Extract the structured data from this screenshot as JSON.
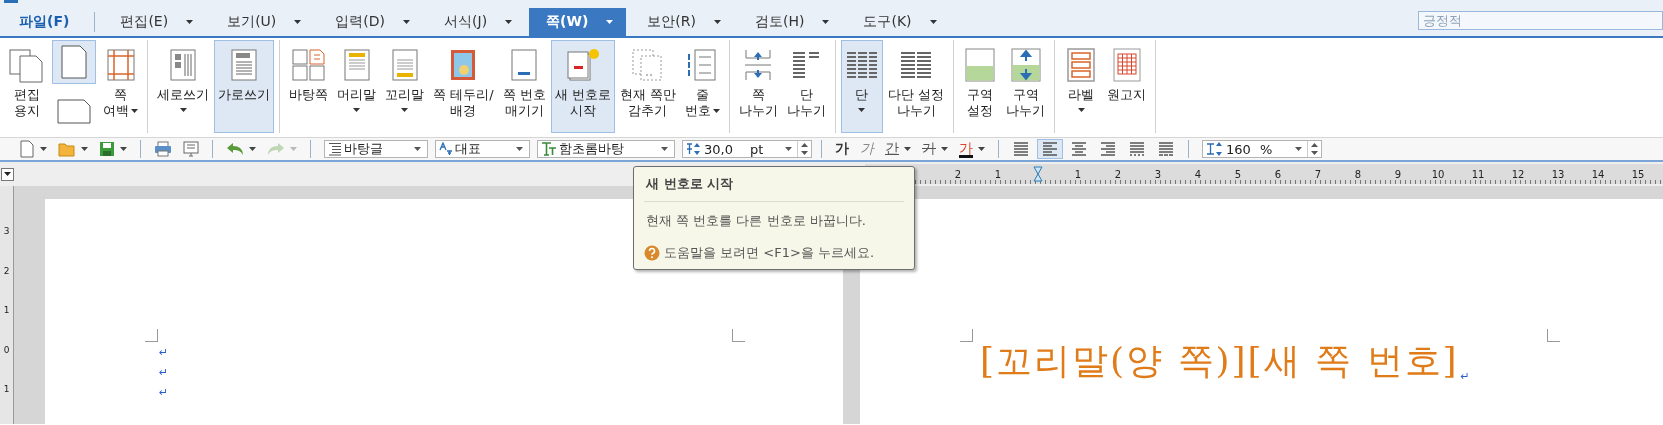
{
  "menu": [
    {
      "label": "파일(F)",
      "kind": "file",
      "selected": false
    },
    {
      "label": "편집(E)",
      "kind": "menu",
      "selected": false
    },
    {
      "label": "보기(U)",
      "kind": "menu",
      "selected": false
    },
    {
      "label": "입력(D)",
      "kind": "menu",
      "selected": false
    },
    {
      "label": "서식(J)",
      "kind": "menu",
      "selected": false
    },
    {
      "label": "쪽(W)",
      "kind": "menu",
      "selected": true
    },
    {
      "label": "보안(R)",
      "kind": "menu",
      "selected": false
    },
    {
      "label": "검토(H)",
      "kind": "menu",
      "selected": false
    },
    {
      "label": "도구(K)",
      "kind": "menu",
      "selected": false
    }
  ],
  "search": {
    "placeholder": "긍정적"
  },
  "ribbon": [
    {
      "items": [
        {
          "kind": "large",
          "lines": [
            "편집",
            "용지"
          ],
          "dropdown": false,
          "selected": false
        },
        {
          "kind": "stack",
          "buttons": [
            {
              "selected": true
            },
            {
              "selected": false
            }
          ]
        },
        {
          "kind": "large",
          "lines": [
            "쪽",
            "여백"
          ],
          "dropdown": true,
          "selected": false
        }
      ]
    },
    {
      "items": [
        {
          "kind": "large",
          "lines": [
            "세로쓰기"
          ],
          "dropdown": true,
          "selected": false
        },
        {
          "kind": "large",
          "lines": [
            "가로쓰기"
          ],
          "dropdown": false,
          "selected": true
        }
      ]
    },
    {
      "items": [
        {
          "kind": "large",
          "lines": [
            "바탕쪽"
          ],
          "dropdown": false,
          "selected": false
        },
        {
          "kind": "large",
          "lines": [
            "머리말"
          ],
          "dropdown": true,
          "selected": false
        },
        {
          "kind": "large",
          "lines": [
            "꼬리말"
          ],
          "dropdown": true,
          "selected": false
        },
        {
          "kind": "large",
          "lines": [
            "쪽 테두리/",
            "배경"
          ],
          "dropdown": false,
          "selected": false
        },
        {
          "kind": "large",
          "lines": [
            "쪽 번호",
            "매기기"
          ],
          "dropdown": false,
          "selected": false
        },
        {
          "kind": "large",
          "lines": [
            "새 번호로",
            "시작"
          ],
          "dropdown": false,
          "selected": true
        },
        {
          "kind": "large",
          "lines": [
            "현재 쪽만",
            "감추기"
          ],
          "dropdown": false,
          "selected": false
        },
        {
          "kind": "large",
          "lines": [
            "줄",
            "번호"
          ],
          "dropdown": true,
          "selected": false
        }
      ]
    },
    {
      "items": [
        {
          "kind": "large",
          "lines": [
            "쪽",
            "나누기"
          ],
          "dropdown": false,
          "selected": false
        },
        {
          "kind": "large",
          "lines": [
            "단",
            "나누기"
          ],
          "dropdown": false,
          "selected": false
        }
      ]
    },
    {
      "items": [
        {
          "kind": "large",
          "lines": [
            "단"
          ],
          "dropdown": true,
          "selected": true
        },
        {
          "kind": "large",
          "lines": [
            "다단 설정",
            "나누기"
          ],
          "dropdown": false,
          "selected": false
        }
      ]
    },
    {
      "items": [
        {
          "kind": "large",
          "lines": [
            "구역",
            "설정"
          ],
          "dropdown": false,
          "selected": false
        },
        {
          "kind": "large",
          "lines": [
            "구역",
            "나누기"
          ],
          "dropdown": false,
          "selected": false
        }
      ]
    },
    {
      "items": [
        {
          "kind": "large",
          "lines": [
            "라벨"
          ],
          "dropdown": true,
          "selected": false
        },
        {
          "kind": "large",
          "lines": [
            "원고지"
          ],
          "dropdown": false,
          "selected": false
        }
      ]
    }
  ],
  "toolbar": [
    {
      "kind": "icon",
      "dropdown": true,
      "disabled": false
    },
    {
      "kind": "icon",
      "dropdown": true,
      "disabled": false
    },
    {
      "kind": "icon",
      "dropdown": true,
      "disabled": false
    },
    {
      "kind": "sep"
    },
    {
      "kind": "icon",
      "dropdown": false,
      "disabled": false
    },
    {
      "kind": "icon",
      "dropdown": false,
      "disabled": false
    },
    {
      "kind": "sep"
    },
    {
      "kind": "icon",
      "dropdown": true,
      "disabled": false
    },
    {
      "kind": "icon",
      "dropdown": true,
      "disabled": true
    },
    {
      "kind": "sep"
    },
    {
      "kind": "combo",
      "value": "바탕글"
    },
    {
      "kind": "combo",
      "value": "대표"
    },
    {
      "kind": "combo",
      "value": "함초롬바탕"
    },
    {
      "kind": "spin",
      "value": "30,0",
      "unit": "pt"
    },
    {
      "kind": "sep"
    },
    {
      "kind": "format",
      "text": "가",
      "dropdown": false
    },
    {
      "kind": "format",
      "text": "가",
      "dropdown": false
    },
    {
      "kind": "format",
      "text": "간",
      "dropdown": true
    },
    {
      "kind": "format",
      "text": "가",
      "dropdown": true
    },
    {
      "kind": "format",
      "text": "가",
      "dropdown": true
    },
    {
      "kind": "sep"
    },
    {
      "kind": "align",
      "selected": false
    },
    {
      "kind": "align",
      "selected": true
    },
    {
      "kind": "align",
      "selected": false
    },
    {
      "kind": "align",
      "selected": false
    },
    {
      "kind": "align",
      "selected": false
    },
    {
      "kind": "align",
      "selected": false
    },
    {
      "kind": "sep"
    },
    {
      "kind": "spin",
      "value": "160",
      "unit": "%"
    }
  ],
  "ruler": {
    "left_labels": [
      "2",
      "1"
    ],
    "right_labels": [
      "1",
      "2",
      "3",
      "4",
      "5",
      "6",
      "7",
      "8",
      "9",
      "10",
      "11",
      "12",
      "13",
      "14",
      "15"
    ]
  },
  "vertical_ruler": [
    "3",
    "2",
    "1",
    "0",
    "1"
  ],
  "left_page": {
    "marks": [
      "↵",
      "↵",
      "↵"
    ]
  },
  "right_page": {
    "text": "[꼬리말(양 쪽)][새 쪽 번호]",
    "end_mark": "↵"
  },
  "tooltip": {
    "title": "새 번호로 시작",
    "body": "현재 쪽 번호를 다른 번호로 바꿉니다.",
    "help": "도움말을 보려면 <F1>을 누르세요."
  }
}
